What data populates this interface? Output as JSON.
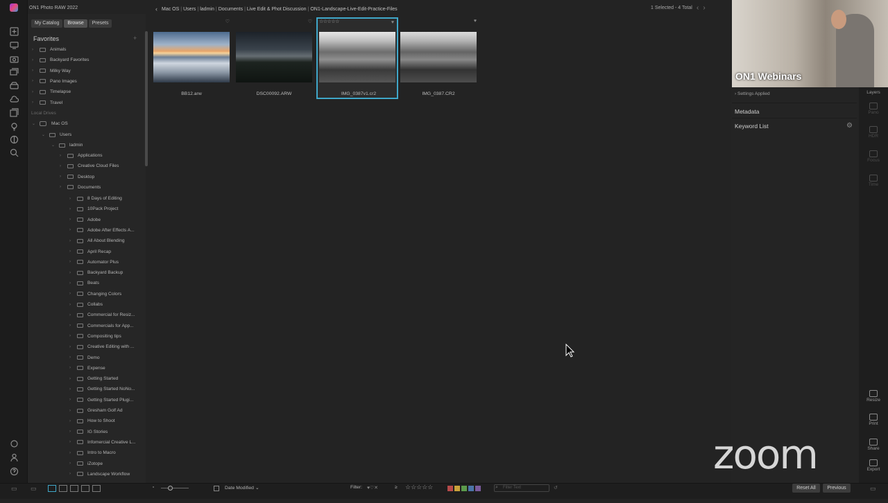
{
  "app": {
    "name": "ON1 Photo RAW 2022"
  },
  "panel": {
    "tabs": [
      "My Catalog",
      "Browse",
      "Presets"
    ],
    "favorites_title": "Favorites",
    "add_label": "+",
    "favorites": [
      "Animals",
      "Backyard Favorites",
      "Milky Way",
      "Pano Images",
      "Timelapse",
      "Travel"
    ],
    "local_drives_label": "Local Drives",
    "drive": "Mac OS",
    "users": "Users",
    "ladmin": "ladmin",
    "level3": [
      "Applications",
      "Creative Cloud Files",
      "Desktop",
      "Documents"
    ],
    "documents_children": [
      "8 Days of Editing",
      "10Pack Project",
      "Adobe",
      "Adobe After Effects A...",
      "All About Blending",
      "April Recap",
      "Automator Plus",
      "Backyard Backup",
      "Beats",
      "Changing Colors",
      "Collabs",
      "Commercial for Resiz...",
      "Commercials for App...",
      "Compositing tips",
      "Creative Editing with ...",
      "Demo",
      "Expense",
      "Getting Started",
      "Getting Started NoNo...",
      "Getting Started Plugi...",
      "Gresham Golf Ad",
      "How to Shoot",
      "IG Stories",
      "Infomercial Creative L...",
      "Intro to Macro",
      "iZotope",
      "Landscape Workflow"
    ]
  },
  "breadcrumb": [
    "Mac OS",
    "Users",
    "ladmin",
    "Documents",
    "Live Edit & Phot Discussion",
    "ON1-Landscape-Live-Edit-Practice-Files"
  ],
  "selection_info": "1 Selected - 4 Total",
  "thumbnails": [
    {
      "name": "BB12.arw"
    },
    {
      "name": "DSC00092.ARW"
    },
    {
      "name": "IMG_0387v1.cr2",
      "stars": "☆☆☆☆☆"
    },
    {
      "name": "IMG_0387.CR2"
    }
  ],
  "right_panel": {
    "settings_applied": "Settings Applied",
    "metadata": "Metadata",
    "keyword_list": "Keyword List"
  },
  "right_toolbar": {
    "layers": "Layers",
    "pano": "Pano",
    "hdr": "HDR",
    "focus": "Focus",
    "time": "Time",
    "resize": "Resize",
    "print": "Print",
    "share": "Share",
    "export": "Export"
  },
  "video": {
    "label": "ON1 Webinars"
  },
  "zoom_logo": "zoom",
  "bottom": {
    "sort": "Date Modified",
    "filter": "Filter:",
    "filter_stars": "☆☆☆☆☆",
    "search_placeholder": "Filter Text",
    "reset_all": "Reset All",
    "previous": "Previous"
  },
  "colors": {
    "selection": "#3fa7c9",
    "label_swatches": [
      "#b54a4a",
      "#c9a13a",
      "#5b9a4b",
      "#4b74a8",
      "#7a5b9c"
    ]
  }
}
